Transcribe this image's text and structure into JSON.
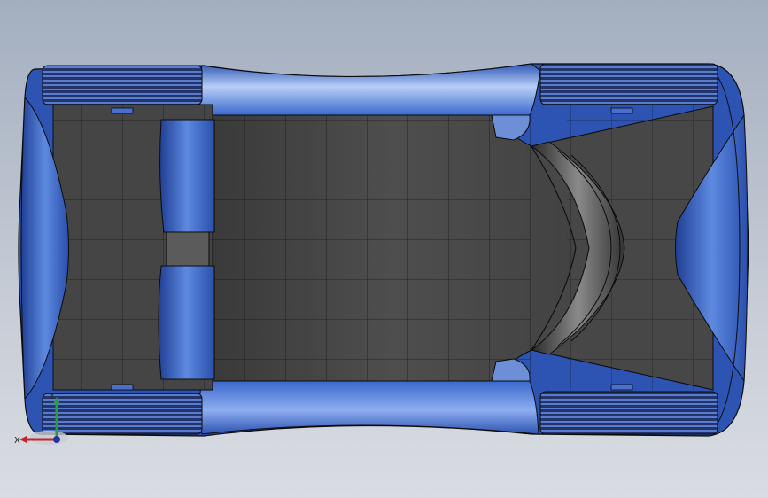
{
  "viewport": {
    "background_top": "#a3aebf",
    "background_bottom": "#d9dce2"
  },
  "model": {
    "body_color": "#3f6fd0",
    "body_highlight": "#9fbef5",
    "interior_color": "#4a4a4a",
    "tire_color": "#22315e",
    "edge_color": "#0b0b0b"
  },
  "triad": {
    "x_label": "X",
    "y_label": "Y",
    "x_color": "#c0262b",
    "y_color": "#2f9c3a",
    "z_color": "#2431a8"
  }
}
